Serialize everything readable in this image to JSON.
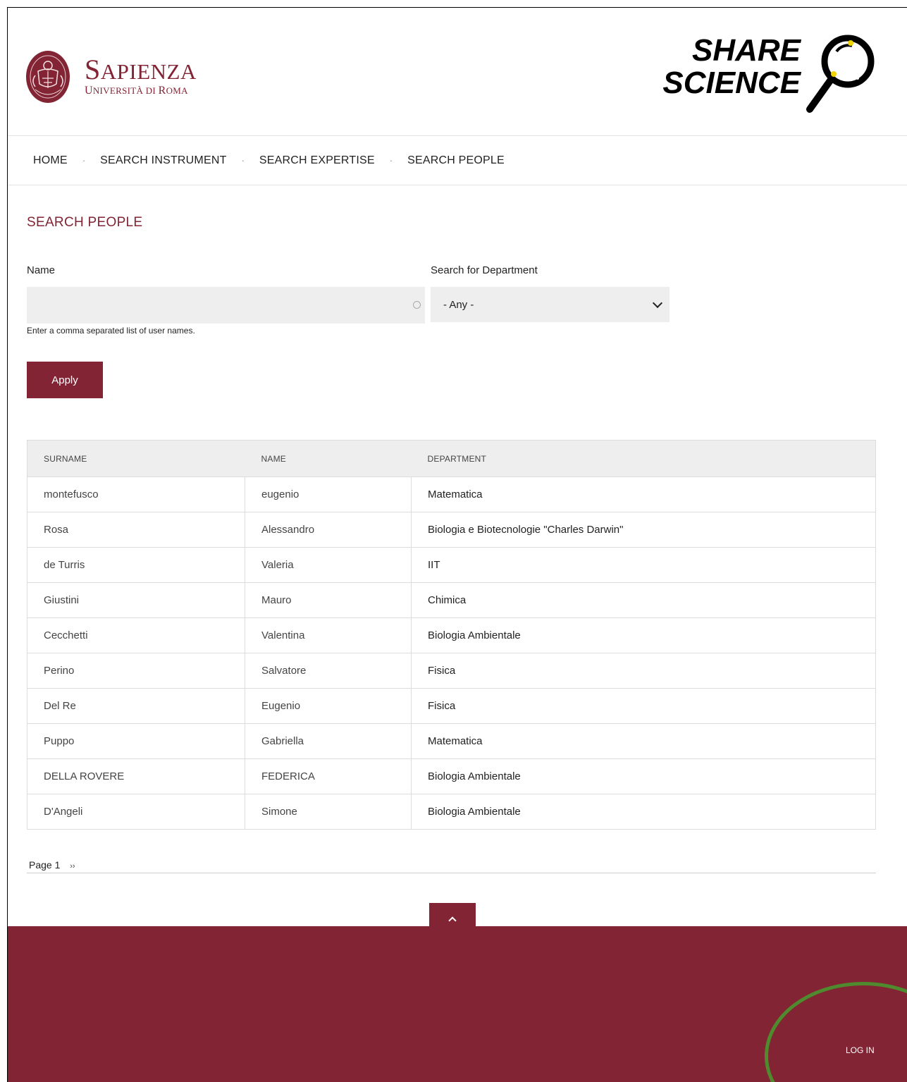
{
  "header": {
    "sapienza_title_big_s": "S",
    "sapienza_title_rest": "APIENZA",
    "sapienza_sub_big_u": "U",
    "sapienza_sub_rest": "NIVERSITÀ DI ",
    "sapienza_sub_big_r": "R",
    "sapienza_sub_rest2": "OMA",
    "share_line1": "SHARE",
    "share_line2": "SCIENCE",
    "brand_color": "#822433"
  },
  "nav": {
    "items": [
      "HOME",
      "SEARCH INSTRUMENT",
      "SEARCH EXPERTISE",
      "SEARCH PEOPLE"
    ],
    "separator": "·"
  },
  "search": {
    "title": "SEARCH PEOPLE",
    "name_label": "Name",
    "name_value": "",
    "name_hint": "Enter a comma separated list of user names.",
    "dept_label": "Search for Department",
    "dept_selected": "- Any -",
    "apply_label": "Apply"
  },
  "table": {
    "headers": [
      "SURNAME",
      "NAME",
      "DEPARTMENT"
    ],
    "rows": [
      [
        "montefusco",
        "eugenio",
        "Matematica"
      ],
      [
        "Rosa",
        "Alessandro",
        "Biologia e Biotecnologie \"Charles Darwin\""
      ],
      [
        "de Turris",
        "Valeria",
        "IIT"
      ],
      [
        "Giustini",
        "Mauro",
        "Chimica"
      ],
      [
        "Cecchetti",
        "Valentina",
        "Biologia Ambientale"
      ],
      [
        "Perino",
        "Salvatore",
        "Fisica"
      ],
      [
        "Del Re",
        "Eugenio",
        "Fisica"
      ],
      [
        "Puppo",
        "Gabriella",
        "Matematica"
      ],
      [
        "DELLA ROVERE",
        "FEDERICA",
        "Biologia Ambientale"
      ],
      [
        "D'Angeli",
        "Simone",
        "Biologia Ambientale"
      ]
    ]
  },
  "pager": {
    "label": "Page 1",
    "next": "››"
  },
  "footer": {
    "login_label": "LOG IN",
    "back_to_top_icon": "chevron-up-icon",
    "annotation_color": "#4f8a2e"
  }
}
